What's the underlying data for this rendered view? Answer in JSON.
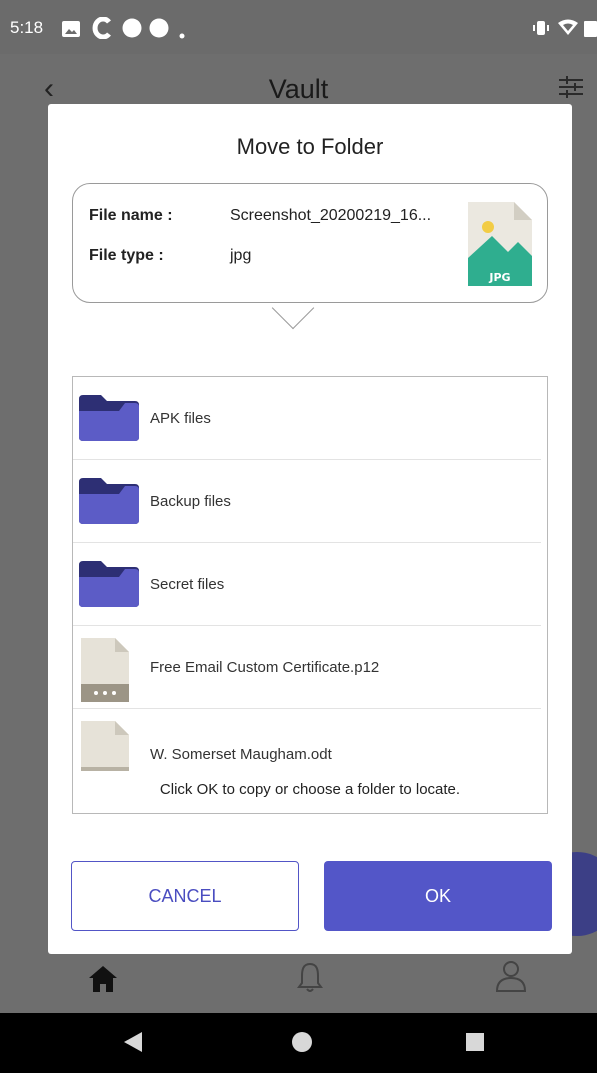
{
  "status_bar": {
    "time": "5:18"
  },
  "app_bar": {
    "title": "Vault"
  },
  "dialog": {
    "title": "Move to Folder",
    "file_info": {
      "name_label": "File name :",
      "name_value": "Screenshot_20200219_16...",
      "type_label": "File type  :",
      "type_value": "jpg",
      "icon_badge": "JPG"
    },
    "items": [
      {
        "label": "APK files",
        "icon": "folder-icon"
      },
      {
        "label": "Backup files",
        "icon": "folder-icon"
      },
      {
        "label": "Secret files",
        "icon": "folder-icon"
      },
      {
        "label": "Free Email Custom Certificate.p12",
        "icon": "certificate-file-icon"
      },
      {
        "label": "W. Somerset Maugham.odt",
        "icon": "document-file-icon"
      }
    ],
    "hint": "Click OK to copy or choose a folder to locate.",
    "cancel_label": "CANCEL",
    "ok_label": "OK"
  },
  "colors": {
    "accent": "#5356c8",
    "folder_front": "#5c5cc6",
    "folder_back": "#2d2f74",
    "jpg_green": "#2fae8f"
  }
}
